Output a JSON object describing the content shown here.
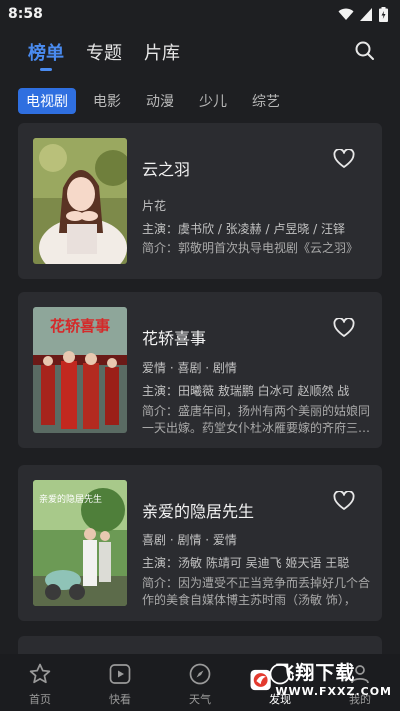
{
  "status_bar": {
    "time": "8:58"
  },
  "top_nav": {
    "tabs": [
      {
        "label": "榜单",
        "active": true
      },
      {
        "label": "专题",
        "active": false
      },
      {
        "label": "片库",
        "active": false
      }
    ],
    "search_icon": "search-icon"
  },
  "sub_tabs": [
    {
      "label": "电视剧",
      "active": true
    },
    {
      "label": "电影",
      "active": false
    },
    {
      "label": "动漫",
      "active": false
    },
    {
      "label": "少儿",
      "active": false
    },
    {
      "label": "综艺",
      "active": false
    }
  ],
  "cards": [
    {
      "title": "云之羽",
      "genre": "片花",
      "cast": "主演：虞书欣 / 张凌赫 / 卢昱晓 / 汪铎",
      "intro": "简介：郭敬明首次执导电视剧《云之羽》",
      "poster_text": ""
    },
    {
      "title": "花轿喜事",
      "genre": "爱情 · 喜剧 · 剧情",
      "cast": "主演：田曦薇 敖瑞鹏 白冰可 赵顺然 战",
      "intro": "简介：盛唐年间，扬州有两个美丽的姑娘同一天出嫁。药堂女仆杜冰雁要嫁的齐府三…",
      "poster_text": "花轿喜事"
    },
    {
      "title": "亲爱的隐居先生",
      "genre": "喜剧 · 剧情 · 爱情",
      "cast": "主演：汤敏 陈靖可 吴迪飞 姬天语 王聪",
      "intro": "简介：因为遭受不正当竞争而丢掉好几个合作的美食自媒体博主苏时雨（汤敏 饰），",
      "poster_text": "亲爱的隐居先生"
    }
  ],
  "bottom_nav": [
    {
      "label": "首页",
      "icon": "star-icon",
      "active": false
    },
    {
      "label": "快看",
      "icon": "play-icon",
      "active": false
    },
    {
      "label": "天气",
      "icon": "compass-icon",
      "active": false
    },
    {
      "label": "发现",
      "icon": "discover-icon",
      "active": true
    },
    {
      "label": "我的",
      "icon": "profile-icon",
      "active": false
    }
  ],
  "watermark": {
    "name": "飞翔下载",
    "url": "WWW.FXXZ.COM"
  },
  "colors": {
    "accent": "#4a8bf0",
    "active_chip": "#2f6fe0",
    "card_bg": "#2b2c30",
    "page_bg": "#1e1f22"
  }
}
